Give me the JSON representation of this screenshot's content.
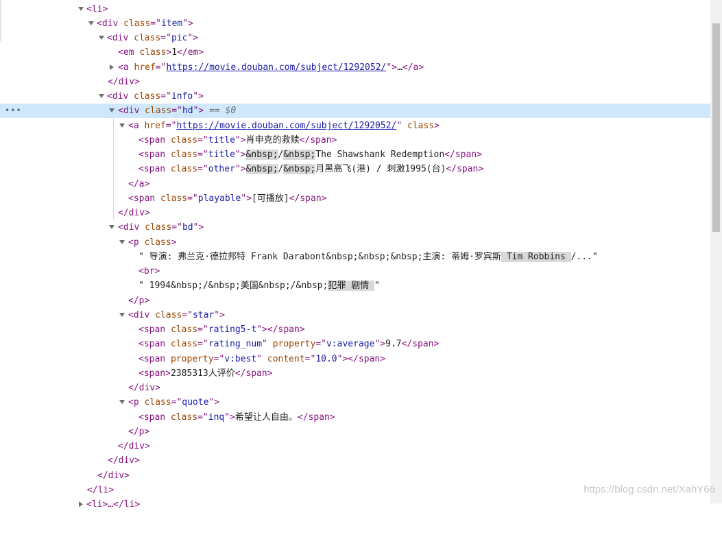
{
  "devtools": {
    "selected_marker": "== $0",
    "more_dots": "•••",
    "lines": {
      "l0": {
        "p1": "<li>"
      },
      "l1": {
        "p1": "<div ",
        "a1": "class",
        "e1": "=\"",
        "v1": "item",
        "e2": "\">"
      },
      "l2": {
        "p1": "<div ",
        "a1": "class",
        "e1": "=\"",
        "v1": "pic",
        "e2": "\">"
      },
      "l3": {
        "p1": "<em ",
        "a1": "class",
        "e1": ">",
        "t1": "1",
        "p2": "</em>"
      },
      "l4": {
        "p1": "<a ",
        "a1": "href",
        "e1": "=\"",
        "v1": "https://movie.douban.com/subject/1292052/",
        "e2": "\">",
        "t1": "…",
        "p2": "</a>"
      },
      "l5": {
        "p1": "</div>"
      },
      "l6": {
        "p1": "<div ",
        "a1": "class",
        "e1": "=\"",
        "v1": "info",
        "e2": "\">"
      },
      "l7": {
        "p1": "<div ",
        "a1": "class",
        "e1": "=\"",
        "v1": "hd",
        "e2": "\">"
      },
      "l8": {
        "p1": "<a ",
        "a1": "href",
        "e1": "=\"",
        "v1": "https://movie.douban.com/subject/1292052/",
        "e2": "\" ",
        "a2": "class",
        "e3": ">"
      },
      "l9": {
        "p1": "<span ",
        "a1": "class",
        "e1": "=\"",
        "v1": "title",
        "e2": "\">",
        "t1": "肖申克的救赎",
        "p2": "</span>"
      },
      "l10": {
        "p1": "<span ",
        "a1": "class",
        "e1": "=\"",
        "v1": "title",
        "e2": "\">",
        "h1": "&nbsp;",
        "t1": "/",
        "h2": "&nbsp;",
        "t2": "The Shawshank Redemption",
        "p2": "</span>"
      },
      "l11": {
        "p1": "<span ",
        "a1": "class",
        "e1": "=\"",
        "v1": "other",
        "e2": "\">",
        "h1": "&nbsp;",
        "t1": "/",
        "h2": "&nbsp;",
        "t2": "月黑高飞(港) / 刺激1995(台)",
        "p2": "</span>"
      },
      "l12": {
        "p1": "</a>"
      },
      "l13": {
        "p1": "<span ",
        "a1": "class",
        "e1": "=\"",
        "v1": "playable",
        "e2": "\">",
        "t1": "[可播放]",
        "p2": "</span>"
      },
      "l14": {
        "p1": "</div>"
      },
      "l15": {
        "p1": "<div ",
        "a1": "class",
        "e1": "=\"",
        "v1": "bd",
        "e2": "\">"
      },
      "l16": {
        "p1": "<p ",
        "a1": "class",
        "e1": ">"
      },
      "l17": {
        "t1": "\" 导演: 弗兰克·德拉邦特 Frank Darabont&nbsp;&nbsp;&nbsp;主演: 蒂姆·罗宾斯",
        "h1": " Tim Robbins ",
        "t2": "/...\""
      },
      "l18": {
        "p1": "<br>"
      },
      "l19": {
        "t1": "\" 1994&nbsp;/&nbsp;美国&nbsp;/&nbsp;",
        "h1": "犯罪 剧情 ",
        "t2": "\""
      },
      "l20": {
        "p1": "</p>"
      },
      "l21": {
        "p1": "<div ",
        "a1": "class",
        "e1": "=\"",
        "v1": "star",
        "e2": "\">"
      },
      "l22": {
        "p1": "<span ",
        "a1": "class",
        "e1": "=\"",
        "v1": "rating5-t",
        "e2": "\">",
        "p2": "</span>"
      },
      "l23": {
        "p1": "<span ",
        "a1": "class",
        "e1": "=\"",
        "v1": "rating_num",
        "e2": "\" ",
        "a2": "property",
        "e3": "=\"",
        "v2": "v:average",
        "e4": "\">",
        "t1": "9.7",
        "p2": "</span>"
      },
      "l24": {
        "p1": "<span ",
        "a1": "property",
        "e1": "=\"",
        "v1": "v:best",
        "e2": "\" ",
        "a2": "content",
        "e3": "=\"",
        "v2": "10.0",
        "e4": "\">",
        "p2": "</span>"
      },
      "l25": {
        "p1": "<span>",
        "t1": "2385313人评价",
        "p2": "</span>"
      },
      "l26": {
        "p1": "</div>"
      },
      "l27": {
        "p1": "<p ",
        "a1": "class",
        "e1": "=\"",
        "v1": "quote",
        "e2": "\">"
      },
      "l28": {
        "p1": "<span ",
        "a1": "class",
        "e1": "=\"",
        "v1": "inq",
        "e2": "\">",
        "t1": "希望让人自由。",
        "p2": "</span>"
      },
      "l29": {
        "p1": "</p>"
      },
      "l30": {
        "p1": "</div>"
      },
      "l31": {
        "p1": "</div>"
      },
      "l32": {
        "p1": "</div>"
      },
      "l33": {
        "p1": "</li>"
      },
      "l34": {
        "p1": "<li>…</li>"
      }
    }
  },
  "watermark": "https://blog.csdn.net/XahY66"
}
